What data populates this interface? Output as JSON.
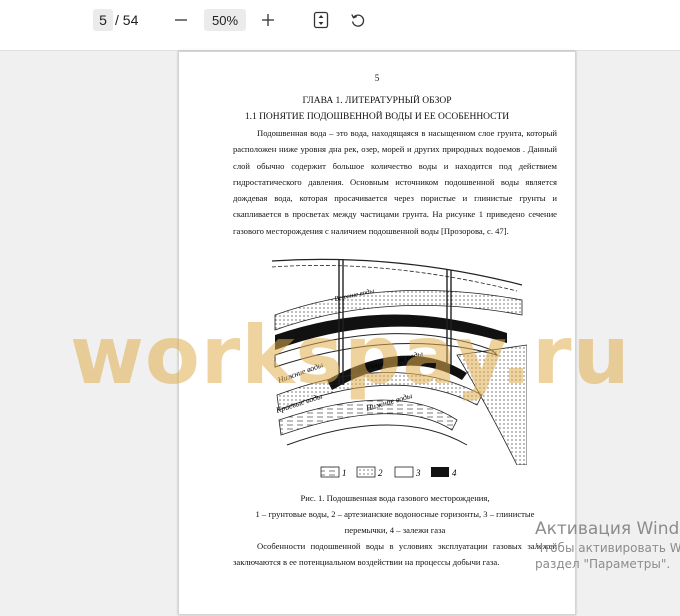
{
  "toolbar": {
    "current_page": "5",
    "total_pages": "/ 54",
    "zoom_out_icon": "minus-icon",
    "zoom_level": "50%",
    "zoom_in_icon": "plus-icon",
    "fit_page_icon": "fit-page-icon",
    "rotate_icon": "rotate-icon"
  },
  "document": {
    "page_number": "5",
    "chapter_title": "ГЛАВА 1. ЛИТЕРАТУРНЫЙ ОБЗОР",
    "section_title": "1.1 ПОНЯТИЕ ПОДОШВЕННОЙ ВОДЫ И ЕЕ ОСОБЕННОСТИ",
    "paragraph1": "Подошвенная вода – это вода, находящаяся в насыщенном слое грунта, который расположен ниже уровня дна рек, озер, морей и других природных водоемов . Данный слой обычно содержит большое количество воды и находится под действием гидростатического давления. Основным источником подошвенной воды является дождевая вода, которая просачивается через пористые и глинистые грунты и скапливается в просветах между частицами грунта. На рисунке 1 приведено сечение газового месторождения с наличием подошвенной воды [Прозорова, с. 47].",
    "figure_labels": {
      "upper": "Подошвенные воды",
      "lower": "Нижние воды",
      "left_bottom": "Краевые воды",
      "left_top": "Нижние воды",
      "top": "Верхние воды"
    },
    "legend": [
      "1",
      "2",
      "3",
      "4"
    ],
    "caption_title": "Рис. 1. Подошвенная вода газового месторождения,",
    "caption_text": "1 – грунтовые воды, 2 – артезианские водоносные горизонты, 3 – глинистые перемычки, 4 – залежи газа",
    "paragraph2": "Особенности подошвенной воды в условиях эксплуатации газовых залежей заключаются в ее потенциальном воздействии на процессы добычи газа."
  },
  "watermark": "workspay.ru",
  "os_notice": {
    "line1": "Активация Windows",
    "line2": "Чтобы активировать Windows, перейдите в",
    "line3": "раздел \"Параметры\"."
  },
  "colors": {
    "toolbar_bg": "#ffffff",
    "viewer_bg": "#f0f0f0",
    "watermark": "#e1af50"
  }
}
